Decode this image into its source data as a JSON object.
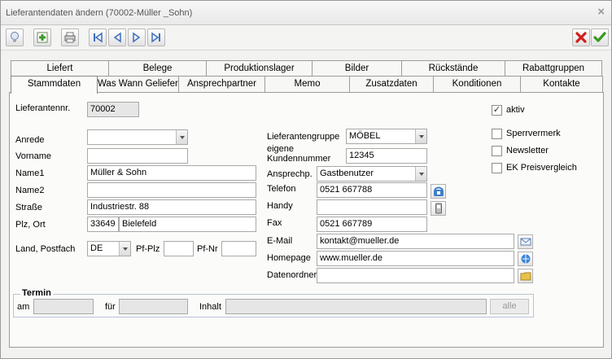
{
  "window": {
    "title": "Lieferantendaten ändern (70002-Müller _Sohn)",
    "close_glyph": "×"
  },
  "toolbar": {
    "left_icons": [
      "lightbulb-icon",
      "add-record-icon",
      "print-icon",
      "first-record-icon",
      "previous-record-icon",
      "next-record-icon",
      "last-record-icon"
    ],
    "right_icons": [
      "cancel-icon",
      "confirm-icon"
    ]
  },
  "tabs_top": [
    "Liefert",
    "Belege",
    "Produktionslager",
    "Bilder",
    "Rückstände",
    "Rabattgruppen"
  ],
  "tabs_bottom": [
    "Stammdaten",
    "Was Wann Geliefert",
    "Ansprechpartner",
    "Memo",
    "Zusatzdaten",
    "Konditionen",
    "Kontakte"
  ],
  "active_tab": "Stammdaten",
  "form": {
    "lieferantennr_label": "Lieferantennr.",
    "lieferantennr": "70002",
    "anrede_label": "Anrede",
    "anrede": "",
    "vorname_label": "Vorname",
    "vorname": "",
    "name1_label": "Name1",
    "name1": "Müller & Sohn",
    "name2_label": "Name2",
    "name2": "",
    "strasse_label": "Straße",
    "strasse": "Industriestr. 88",
    "plzort_label": "Plz, Ort",
    "plz": "33649",
    "ort": "Bielefeld",
    "land_label": "Land, Postfach",
    "land": "DE",
    "pfplz_label": "Pf-Plz",
    "pfplz": "",
    "pfnr_label": "Pf-Nr",
    "pfnr": "",
    "gruppe_label": "Lieferantengruppe",
    "gruppe": "MÖBEL",
    "kundennr_label_1": "eigene",
    "kundennr_label_2": "Kundennummer",
    "kundennr": "12345",
    "ansprech_label": "Ansprechp.",
    "ansprech": "Gastbenutzer",
    "telefon_label": "Telefon",
    "telefon": "0521 667788",
    "handy_label": "Handy",
    "handy": "",
    "fax_label": "Fax",
    "fax": "0521 667789",
    "email_label": "E-Mail",
    "email": "kontakt@mueller.de",
    "homepage_label": "Homepage",
    "homepage": "www.mueller.de",
    "datenordner_label": "Datenordner",
    "datenordner": ""
  },
  "checkboxes": [
    {
      "label": "aktiv",
      "checked": true
    },
    {
      "label": "Sperrvermerk",
      "checked": false
    },
    {
      "label": "Newsletter",
      "checked": false
    },
    {
      "label": "EK Preisvergleich",
      "checked": false
    }
  ],
  "termin": {
    "title": "Termin",
    "am_label": "am",
    "fuer_label": "für",
    "inhalt_label": "Inhalt",
    "button": "alle"
  }
}
